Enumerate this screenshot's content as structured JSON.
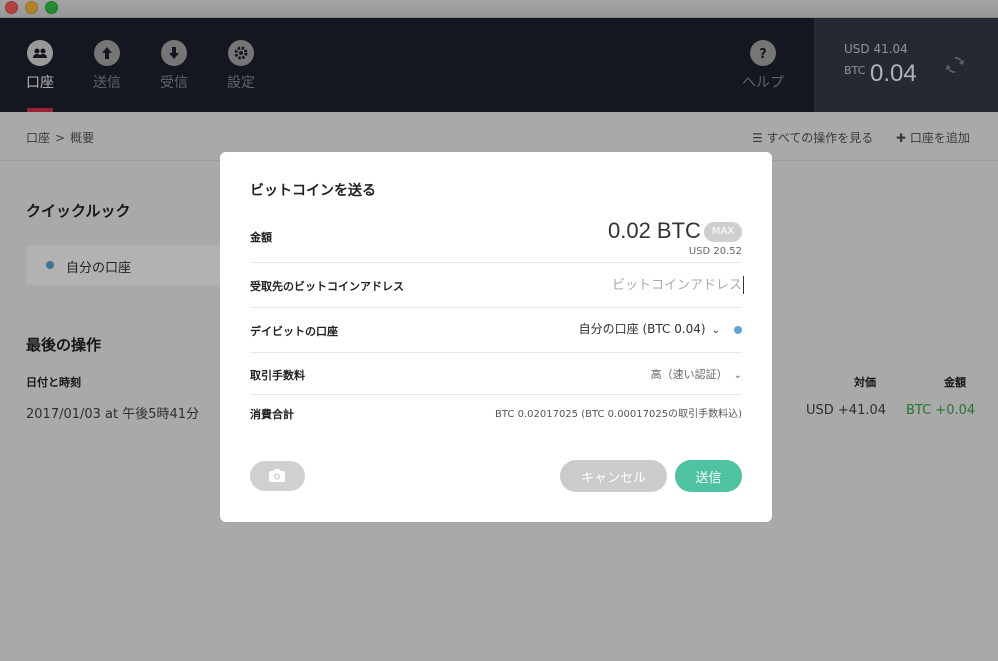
{
  "nav": {
    "items": [
      {
        "label": "口座",
        "icon": "users-icon"
      },
      {
        "label": "送信",
        "icon": "upload-icon"
      },
      {
        "label": "受信",
        "icon": "download-icon"
      },
      {
        "label": "設定",
        "icon": "gear-icon"
      }
    ],
    "help_label": "ヘルプ"
  },
  "balance": {
    "usd": "USD 41.04",
    "btc_label": "BTC",
    "btc_value": "0.04"
  },
  "breadcrumb": {
    "root": "口座",
    "sep": ">",
    "current": "概要"
  },
  "top_links": {
    "all_ops": "すべての操作を見る",
    "add_account": "口座を追加"
  },
  "quicklook": {
    "title": "クイックルック",
    "account_name": "自分の口座"
  },
  "last_ops": {
    "title": "最後の操作",
    "columns": {
      "datetime": "日付と時刻",
      "counter": "対価",
      "amount": "金額"
    },
    "rows": [
      {
        "datetime": "2017/01/03 at 午後5時41分",
        "counter": "USD +41.04",
        "amount": "BTC +0.04"
      }
    ]
  },
  "modal": {
    "title": "ビットコインを送る",
    "amount_label": "金額",
    "amount_value": "0.02  BTC",
    "max_label": "MAX",
    "amount_usd": "USD 20.52",
    "address_label": "受取先のビットコインアドレス",
    "address_placeholder": "ビットコインアドレス",
    "debit_label": "デイビットの口座",
    "debit_value": "自分の口座 (BTC 0.04)",
    "fee_label": "取引手数料",
    "fee_value": "高（速い認証）",
    "total_label": "消費合計",
    "total_value": "BTC 0.02017025 (BTC 0.00017025の取引手数料込)",
    "cancel_label": "キャンセル",
    "send_label": "送信"
  },
  "colors": {
    "accent_red": "#e0324a",
    "send_green": "#4fc3a1",
    "positive_green": "#3aa64a",
    "nav_bg": "#1d222d"
  }
}
